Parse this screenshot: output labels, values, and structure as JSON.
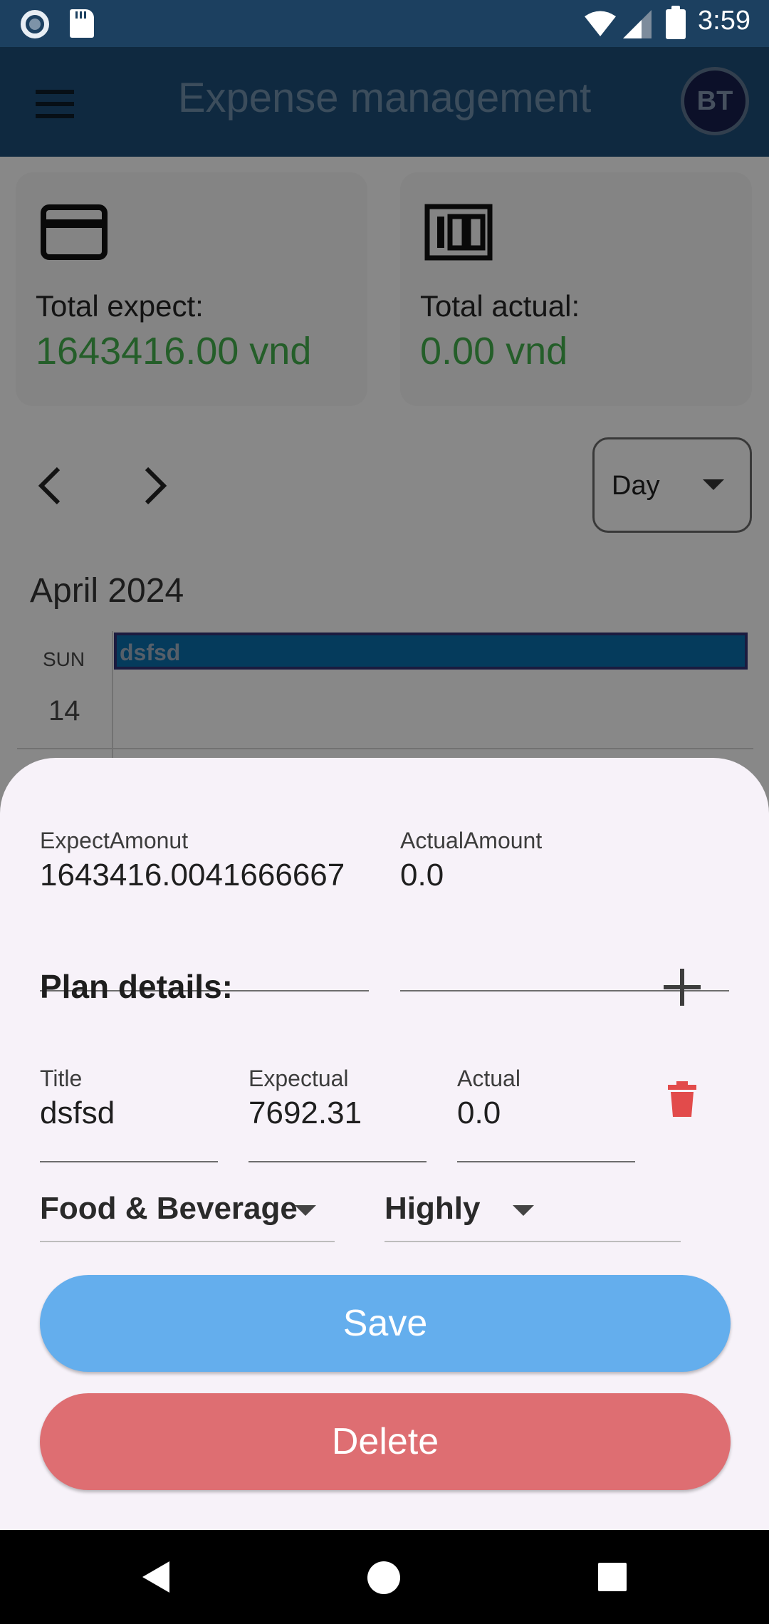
{
  "status_bar": {
    "time": "3:59"
  },
  "app_bar": {
    "title": "Expense management",
    "avatar_initials": "BT"
  },
  "summary": {
    "expect_label": "Total expect:",
    "expect_value": "1643416.00 vnd",
    "actual_label": "Total actual:",
    "actual_value": "0.00 vnd",
    "value_color": "#41a84a"
  },
  "calendar": {
    "range_selected": "Day",
    "month_label": "April 2024",
    "day_name": "SUN",
    "day_number": "14",
    "event_title": "dsfsd",
    "event_color": "#0a6aa4"
  },
  "sheet": {
    "expect_amount": {
      "label": "ExpectAmonut",
      "value": "1643416.0041666667"
    },
    "actual_amount": {
      "label": "ActualAmount",
      "value": "0.0"
    },
    "plan_details_title": "Plan details:",
    "plan_item": {
      "title_label": "Title",
      "title_value": "dsfsd",
      "expectual_label": "Expectual",
      "expectual_value": "7692.31",
      "actual_label": "Actual",
      "actual_value": "0.0",
      "category": "Food & Beverage",
      "priority": "Highly"
    },
    "save_label": "Save",
    "delete_label": "Delete",
    "save_color": "#64aeed",
    "delete_color": "#de6e72"
  },
  "icons": {
    "status": [
      "record-icon",
      "sd-card-icon",
      "wifi-icon",
      "signal-icon",
      "battery-icon"
    ],
    "app_bar": [
      "menu-icon"
    ],
    "cards": [
      "credit-card-icon",
      "hundred-points-icon"
    ],
    "navigation": [
      "chevron-left-icon",
      "chevron-right-icon"
    ],
    "sheet": [
      "add-icon",
      "trash-icon"
    ],
    "nav_bar": [
      "back-icon",
      "home-icon",
      "recents-icon"
    ]
  }
}
